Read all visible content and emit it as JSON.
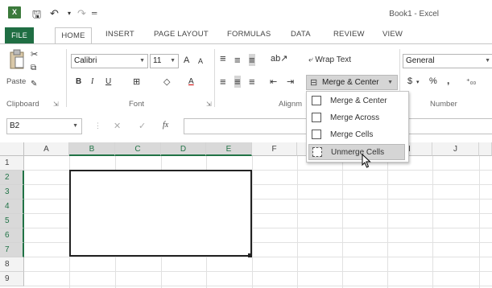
{
  "window": {
    "title": "Book1 - Excel"
  },
  "qat": {
    "save": "🖫",
    "undo": "↶",
    "redo": "↷",
    "customize": "⇟"
  },
  "tabs": [
    "FILE",
    "HOME",
    "INSERT",
    "PAGE LAYOUT",
    "FORMULAS",
    "DATA",
    "REVIEW",
    "VIEW"
  ],
  "ribbon": {
    "clipboard": {
      "paste": "Paste",
      "group": "Clipboard"
    },
    "font": {
      "name": "Calibri",
      "size": "11",
      "bold": "B",
      "italic": "I",
      "underline": "U",
      "grow": "A",
      "shrink": "A",
      "color": "A",
      "group": "Font"
    },
    "alignment": {
      "wrap_text": "Wrap Text",
      "merge_center": "Merge & Center",
      "group": "Alignm"
    },
    "number": {
      "format": "General",
      "currency": "$",
      "percent": "%",
      "comma": ",",
      "group": "Number"
    }
  },
  "formula_bar": {
    "name_box": "B2",
    "cancel": "✕",
    "enter": "✓",
    "fx": "fx",
    "value": ""
  },
  "columns": [
    "A",
    "B",
    "C",
    "D",
    "E",
    "F",
    "G",
    "H",
    "I",
    "J"
  ],
  "rows": [
    "1",
    "2",
    "3",
    "4",
    "5",
    "6",
    "7",
    "8",
    "9"
  ],
  "menu": {
    "items": [
      {
        "label": "Merge & Center",
        "icon": "merge-center-icon"
      },
      {
        "label": "Merge Across",
        "icon": "merge-across-icon"
      },
      {
        "label": "Merge Cells",
        "icon": "merge-cells-icon"
      },
      {
        "label": "Unmerge Cells",
        "icon": "unmerge-cells-icon"
      }
    ],
    "hovered": "Unmerge Cells"
  },
  "colors": {
    "accent": "#217346",
    "file_tab": "#1f6e43"
  }
}
